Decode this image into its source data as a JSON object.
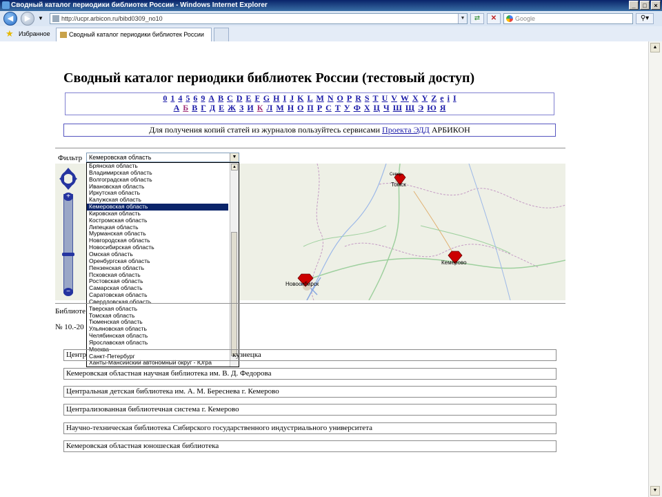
{
  "window": {
    "title": "Сводный каталог периодики библиотек России - Windows Internet Explorer",
    "minimize": "_",
    "maximize": "□",
    "close": "×"
  },
  "address": {
    "url": "http://ucpr.arbicon.ru/bibd0309_no10",
    "search_placeholder": "Google"
  },
  "favorites": {
    "label": "Избранное",
    "tab_title": "Сводный каталог периодики библиотек России"
  },
  "page": {
    "title": "Сводный каталог периодики библиотек России (тестовый доступ)",
    "latin_letters": [
      "0",
      "1",
      "4",
      "5",
      "6",
      "9",
      "A",
      "B",
      "C",
      "D",
      "E",
      "F",
      "G",
      "H",
      "I",
      "J",
      "K",
      "L",
      "M",
      "N",
      "O",
      "P",
      "R",
      "S",
      "T",
      "U",
      "V",
      "W",
      "X",
      "Y",
      "Z",
      "e",
      "i",
      "I"
    ],
    "cyrillic_letters": [
      "А",
      "Б",
      "В",
      "Г",
      "Д",
      "Е",
      "Ж",
      "З",
      "И",
      "К",
      "Л",
      "М",
      "Н",
      "О",
      "П",
      "Р",
      "С",
      "Т",
      "У",
      "Ф",
      "Х",
      "Ц",
      "Ч",
      "Ш",
      "Щ",
      "Э",
      "Ю",
      "Я"
    ],
    "visited_letters": [
      "Б",
      "К"
    ],
    "info_text_before": "Для получения копий статей из журналов пользуйтесь сервисами ",
    "info_link": "Проекта ЭДД",
    "info_text_after": " АРБИКОН",
    "filter_label": "Фильтр",
    "filter_selected": "Кемеровская область",
    "region_options": [
      "Брянская область",
      "Владимирская область",
      "Волгоградская область",
      "Ивановская область",
      "Иркутская область",
      "Калужская область",
      "Кемеровская область",
      "Кировская область",
      "Костромская область",
      "Липецкая область",
      "Мурманская область",
      "Новгородская область",
      "Новосибирская область",
      "Омская область",
      "Оренбургская область",
      "Пензенская область",
      "Псковская область",
      "Ростовская область",
      "Самарская область",
      "Саратовская область",
      "Свердловская область",
      "Тверская область",
      "Томская область",
      "Тюменская область",
      "Ульяновская область",
      "Челябинская область",
      "Ярославская область",
      "Москва",
      "Санкт-Петербург",
      "Ханты-Мансийский автономный округ - Югра"
    ],
    "selected_index": 6,
    "map_cities": [
      {
        "name": "Томск"
      },
      {
        "name": "Кемерово"
      },
      {
        "name": "Новосибирск"
      },
      {
        "name": "Север"
      }
    ],
    "library_label_visible": "Библиоте",
    "issue_visible": "№ 10.-20",
    "first_library_visible_start": "Центр",
    "first_library_visible_tail": "кузнецка",
    "libraries": [
      "Кемеровская областная научная библиотека им. В. Д. Федорова",
      "Центральная детская библиотека им. А. М. Береснева г. Кемерово",
      "Централизованная библиотечная система г. Кемерово",
      "Научно-техническая библиотека Сибирского государственного индустриального университета",
      "Кемеровская областная юношеская библиотека"
    ]
  },
  "colors": {
    "link": "#1a1aa8",
    "visited": "#a0307a",
    "selection": "#0a246a",
    "marker": "#cc0000"
  }
}
